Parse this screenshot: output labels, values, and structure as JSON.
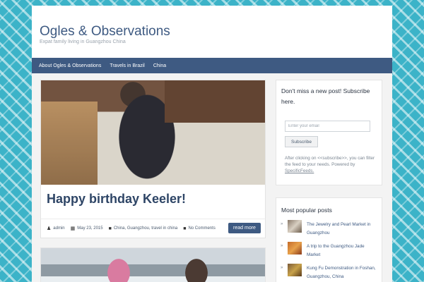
{
  "site": {
    "title": "Ogles & Observations",
    "tagline": "Expat family living in Guangzhou China"
  },
  "nav": {
    "items": [
      {
        "label": "About Ogles & Observations"
      },
      {
        "label": "Travels in Brazil"
      },
      {
        "label": "China"
      }
    ]
  },
  "post": {
    "title": "Happy birthday Keeler!",
    "author": "admin",
    "date": "May 23, 2015",
    "categories": "China, Guangzhou, travel in china",
    "comments": "No Comments",
    "read_more": "read more"
  },
  "subscribe": {
    "title": "Don't miss a new post! Subscribe here.",
    "email_placeholder": "Enter your email",
    "button": "Subscribe",
    "note_before": "After clicking on <<subscribe>>, you can filter the feed to your needs. Powered by ",
    "note_link": "SpecificFeeds."
  },
  "popular": {
    "title": "Most popular posts",
    "items": [
      {
        "label": "The Jewelry and Pearl Market in Guangzhou"
      },
      {
        "label": "A trip to the Guangzhou Jade Market"
      },
      {
        "label": "Kung Fu Demonstration in Foshan, Guangzhou, China"
      }
    ]
  },
  "colors": {
    "accent": "#3e5a82",
    "background_pattern": "#3cb3c8"
  },
  "icons": {
    "author": "person-icon",
    "date": "calendar-icon",
    "category": "folder-icon",
    "comments": "comment-icon",
    "bullet": "arrow-bullet-icon"
  }
}
